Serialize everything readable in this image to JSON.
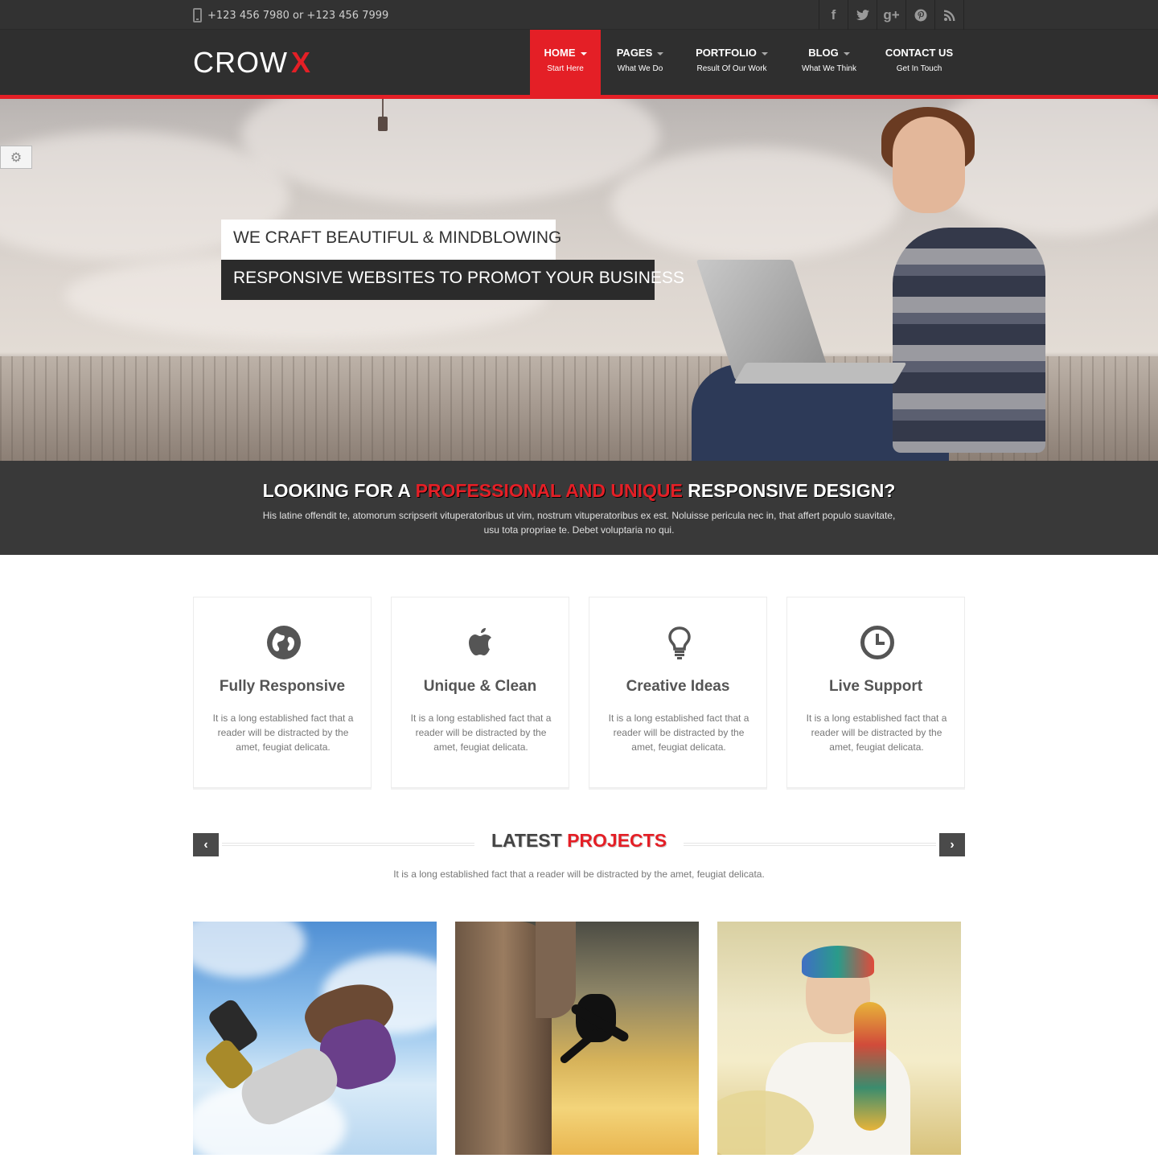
{
  "topbar": {
    "phone": "+123 456 7980 or +123 456 7999",
    "social": [
      {
        "icon": "facebook-icon",
        "glyph": "f"
      },
      {
        "icon": "twitter-icon",
        "glyph": "t"
      },
      {
        "icon": "google-plus-icon",
        "glyph": "g+"
      },
      {
        "icon": "pinterest-icon",
        "glyph": "P"
      },
      {
        "icon": "rss-icon",
        "glyph": "))"
      }
    ]
  },
  "header": {
    "logo_text": "CROW",
    "logo_mark": "X",
    "nav": [
      {
        "label": "HOME",
        "sub": "Start Here",
        "active": true,
        "caret": true
      },
      {
        "label": "PAGES",
        "sub": "What We Do",
        "active": false,
        "caret": true
      },
      {
        "label": "PORTFOLIO",
        "sub": "Result Of Our Work",
        "active": false,
        "caret": true
      },
      {
        "label": "BLOG",
        "sub": "What We Think",
        "active": false,
        "caret": true
      },
      {
        "label": "CONTACT US",
        "sub": "Get In Touch",
        "active": false,
        "caret": false
      }
    ]
  },
  "hero": {
    "line1": "WE CRAFT BEAUTIFUL & MINDBLOWING",
    "line2": "RESPONSIVE WEBSITES TO PROMOT YOUR BUSINESS"
  },
  "band": {
    "title_pre": "LOOKING FOR A ",
    "title_highlight": "PROFESSIONAL AND UNIQUE",
    "title_post": " RESPONSIVE DESIGN?",
    "text": "His latine offendit te, atomorum scripserit vituperatoribus ut vim, nostrum vituperatoribus ex est. Noluisse pericula nec in, that affert populo suavitate, usu tota propriae te. Debet voluptaria no qui."
  },
  "features": [
    {
      "icon": "globe-icon",
      "title": "Fully Responsive",
      "text": "It is a long established fact that a reader will be distracted by the amet, feugiat delicata."
    },
    {
      "icon": "apple-icon",
      "title": "Unique & Clean",
      "text": "It is a long established fact that a reader will be distracted by the amet, feugiat delicata."
    },
    {
      "icon": "lightbulb-icon",
      "title": "Creative Ideas",
      "text": "It is a long established fact that a reader will be distracted by the amet, feugiat delicata."
    },
    {
      "icon": "clock-icon",
      "title": "Live Support",
      "text": "It is a long established fact that a reader will be distracted by the amet, feugiat delicata."
    }
  ],
  "projects": {
    "title_pre": "LATEST ",
    "title_highlight": "PROJECTS",
    "desc": "It is a long established fact that a reader will be distracted by the amet, feugiat delicata.",
    "prev": "‹",
    "next": "›"
  },
  "colors": {
    "accent": "#e41f26",
    "dark": "#2f2f2f",
    "band": "#393939"
  }
}
